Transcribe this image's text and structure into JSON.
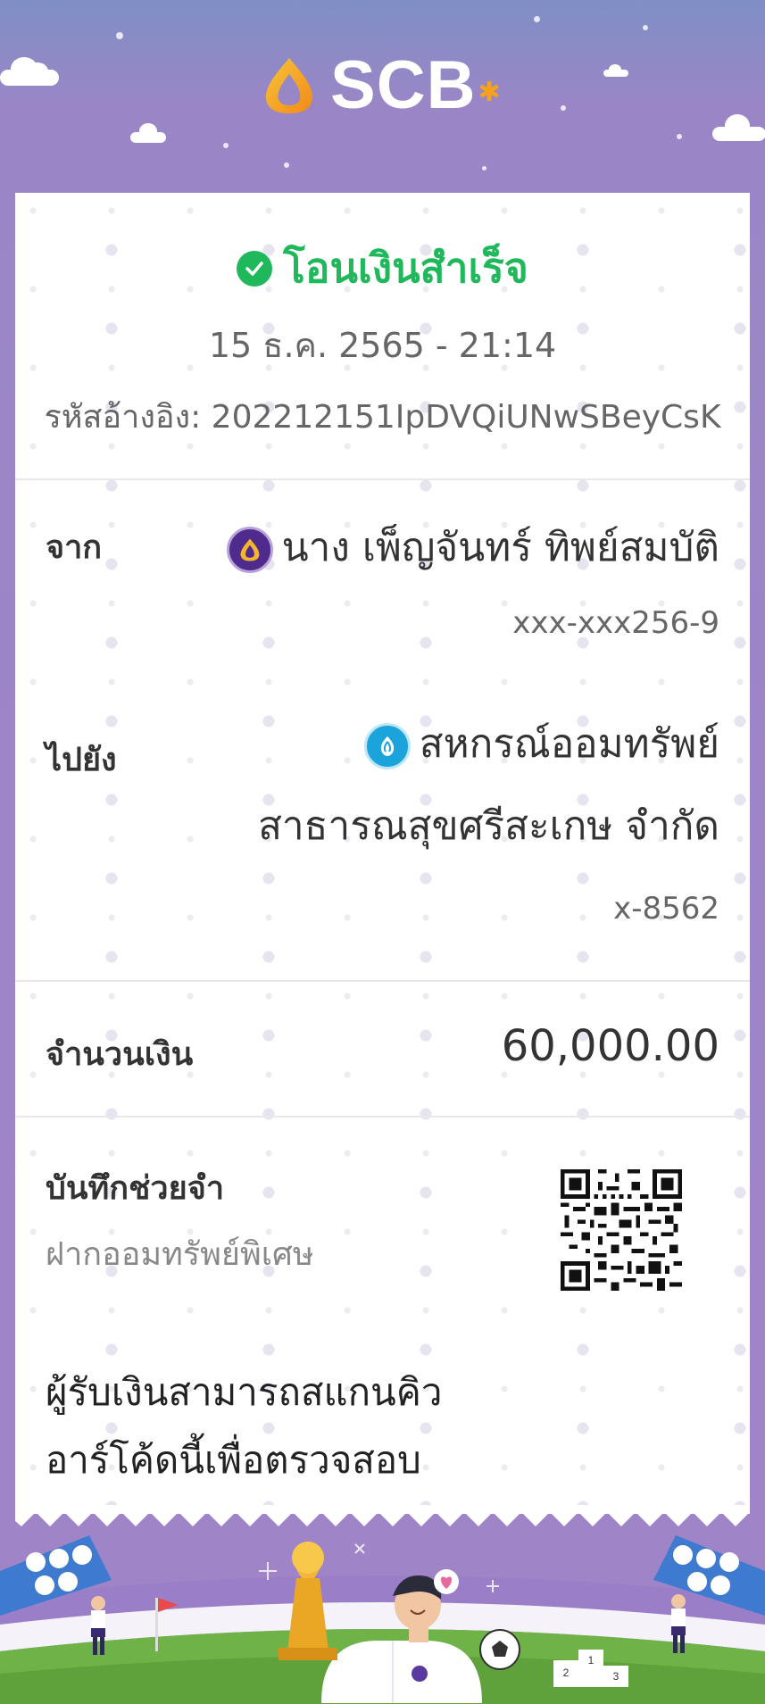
{
  "brand": {
    "name": "SCB",
    "primary_color": "#4e2b8c",
    "accent_color": "#f7a21b",
    "success_color": "#1fb85a"
  },
  "status": {
    "icon": "check-circle-icon",
    "text": "โอนเงินสำเร็จ"
  },
  "transaction": {
    "datetime": "15 ธ.ค. 2565 - 21:14",
    "reference": "รหัสอ้างอิง: 202212151IpDVQiUNwSBeyCsK"
  },
  "from": {
    "label": "จาก",
    "bank_icon": "scb-bank-icon",
    "name": "นาง เพ็ญจันทร์ ทิพย์สมบัติ",
    "account": "xxx-xxx256-9"
  },
  "to": {
    "label": "ไปยัง",
    "bank_icon": "ktb-bank-icon",
    "name_line1": "สหกรณ์ออมทรัพย์",
    "name_line2": "สาธารณสุขศรีสะเกษ จำกัด",
    "account": "x-8562"
  },
  "amount": {
    "label": "จำนวนเงิน",
    "value": "60,000.00"
  },
  "memo": {
    "label": "บันทึกช่วยจำ",
    "text": "ฝากออมทรัพย์พิเศษ"
  },
  "qr_section": {
    "line1": "ผู้รับเงินสามารถสแกนคิว",
    "line2": "อาร์โค้ดนี้เพื่อตรวจสอบ",
    "icon": "qr-code"
  },
  "footer": {
    "illustration": "football-celebration-illustration",
    "podium_labels": [
      "2",
      "1",
      "3"
    ]
  }
}
